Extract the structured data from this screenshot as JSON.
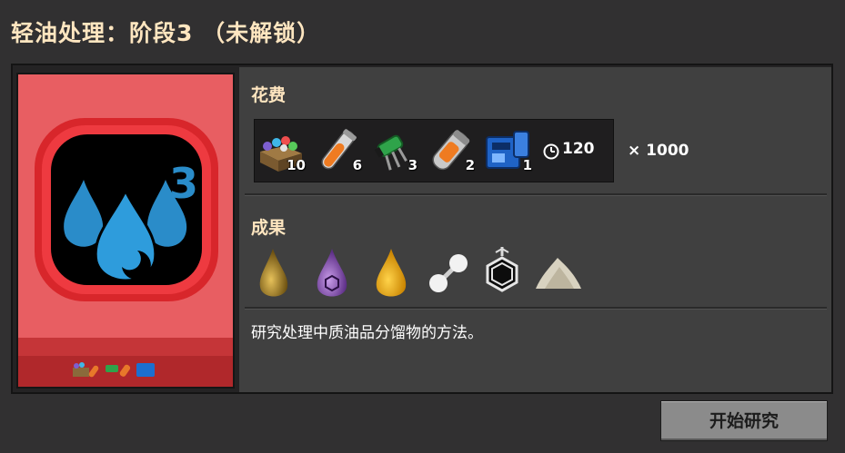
{
  "title": "轻油处理：阶段3 （未解锁）",
  "cost": {
    "label": "花费",
    "ingredients": [
      {
        "icon": "production-science-pack-icon",
        "count": "10"
      },
      {
        "icon": "test-tube-orange-icon",
        "count": "6"
      },
      {
        "icon": "green-circuit-component-icon",
        "count": "3"
      },
      {
        "icon": "capsule-orange-icon",
        "count": "2"
      },
      {
        "icon": "blue-machine-pack-icon",
        "count": "1"
      }
    ],
    "time": "120",
    "multiplier": "× 1000"
  },
  "effects": {
    "label": "成果",
    "items": [
      "heavy-oil-drop-icon",
      "purple-fluid-drop-icon",
      "light-oil-drop-icon",
      "molecule-icon",
      "benzene-ring-icon",
      "powder-pile-icon"
    ]
  },
  "description": "研究处理中质油品分馏物的方法。",
  "start_button": "开始研究",
  "tech_badge": "3",
  "colors": {
    "card": "#e85e62",
    "card_dark": "#b0282b",
    "drop": "#2a8cc9",
    "title": "#ffe6c0"
  }
}
